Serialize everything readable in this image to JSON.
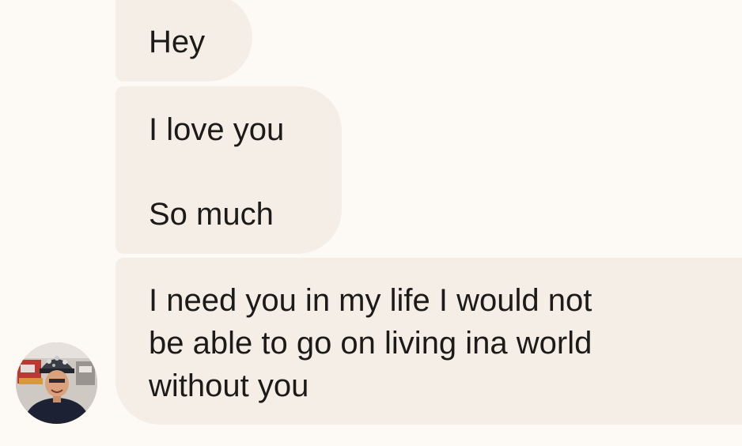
{
  "conversation": {
    "messages": [
      {
        "lines": [
          "Hey"
        ]
      },
      {
        "lines": [
          "I love you",
          "So much"
        ]
      },
      {
        "lines": [
          "I need you in my life I would not",
          "be able to go on living ina world",
          "without you"
        ]
      }
    ]
  },
  "colors": {
    "background": "#fdfaf6",
    "bubble": "#f5eee6",
    "text": "#1d1b19"
  },
  "icons": {
    "avatar": "contact-avatar-photo"
  }
}
